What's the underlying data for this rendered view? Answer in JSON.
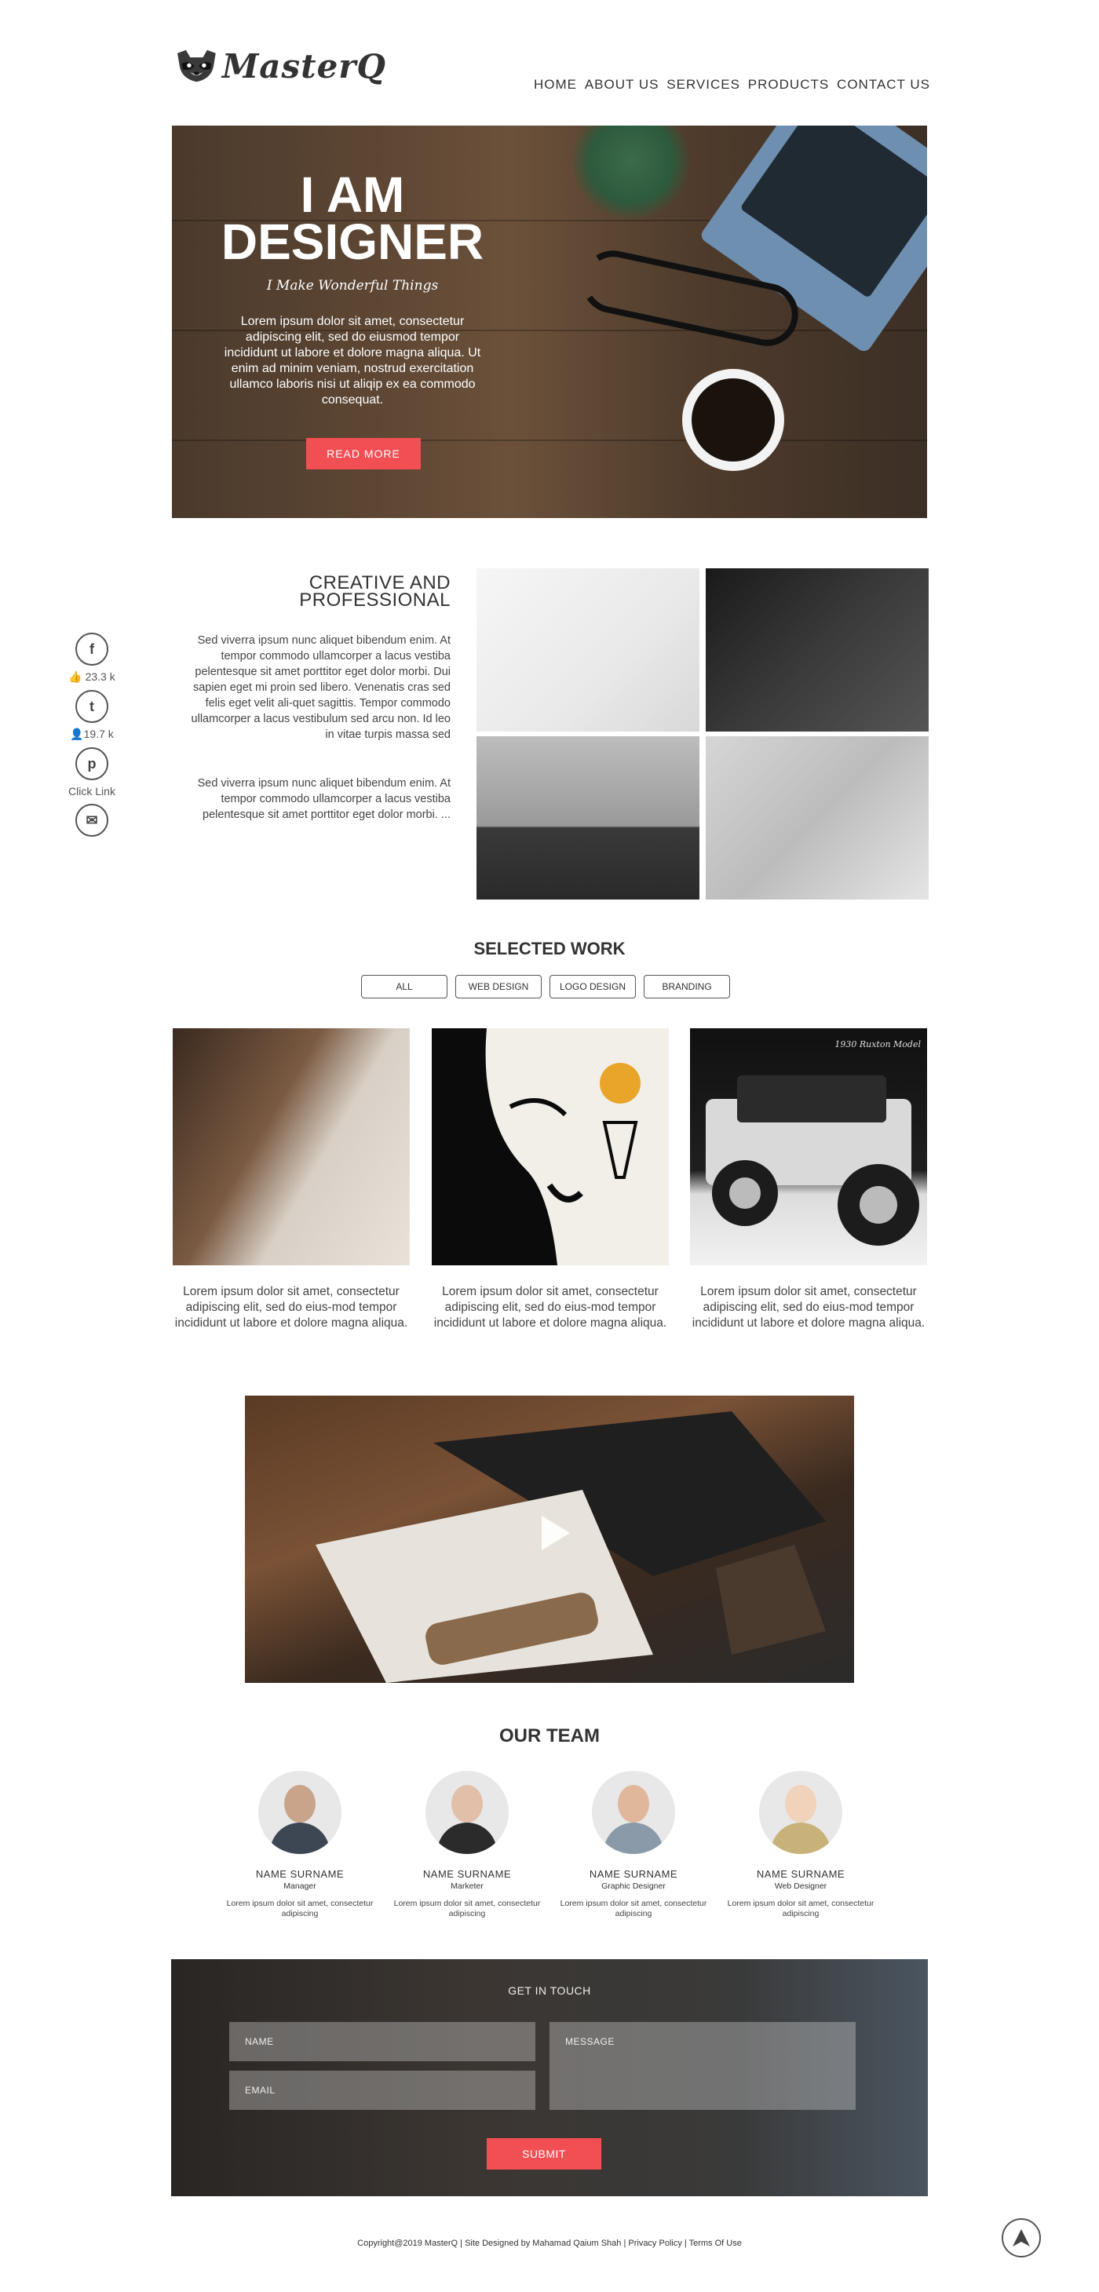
{
  "brand": {
    "name": "MasterQ",
    "logo_icon": "raccoon-logo-icon"
  },
  "nav": {
    "items": [
      {
        "label": "HOME"
      },
      {
        "label": "ABOUT US"
      },
      {
        "label": "SERVICES"
      },
      {
        "label": "PRODUCTS"
      },
      {
        "label": "CONTACT US"
      }
    ]
  },
  "hero": {
    "title_line1": "I AM",
    "title_line2": "DESIGNER",
    "subtitle": "I Make Wonderful Things",
    "body": "Lorem ipsum dolor sit amet, consectetur adipiscing elit, sed do eiusmod tempor incididunt ut labore et dolore magna aliqua. Ut enim ad minim veniam, nostrud exercitation ullamco laboris nisi ut aliqip ex ea commodo consequat.",
    "button": "READ MORE"
  },
  "social": {
    "items": [
      {
        "icon": "facebook-icon",
        "glyph": "f",
        "count": "23.3 k",
        "count_icon": "thumbs-up-icon"
      },
      {
        "icon": "twitter-icon",
        "glyph": "t",
        "count": "19.7 k",
        "count_icon": "user-icon"
      },
      {
        "icon": "pinterest-icon",
        "glyph": "p",
        "count": "Click Link",
        "count_icon": ""
      },
      {
        "icon": "mail-icon",
        "glyph": "✉",
        "count": "",
        "count_icon": ""
      }
    ]
  },
  "creative": {
    "title_line1": "CREATIVE AND",
    "title_line2": "PROFESSIONAL",
    "p1": "Sed viverra ipsum nunc aliquet bibendum enim. At tempor commodo ullamcorper a lacus vestiba pelentesque sit amet porttitor eget dolor morbi. Dui sapien eget mi proin sed libero. Venenatis cras sed felis eget velit ali-quet sagittis. Tempor commodo ullamcorper a lacus vestibulum sed arcu non. Id leo in vitae turpis massa sed",
    "p2": "Sed viverra ipsum nunc aliquet bibendum enim. At tempor commodo ullamcorper a lacus vestiba pelentesque sit amet porttitor eget dolor morbi. ..."
  },
  "selected_work": {
    "title": "SELECTED WORK",
    "filters": [
      {
        "label": "ALL"
      },
      {
        "label": "WEB DESIGN"
      },
      {
        "label": "LOGO DESIGN"
      },
      {
        "label": "BRANDING"
      }
    ],
    "items": [
      {
        "caption": "Lorem ipsum dolor sit amet, consectetur adipiscing elit, sed do eius-mod tempor incididunt ut labore et dolore magna aliqua."
      },
      {
        "caption": "Lorem ipsum dolor sit amet, consectetur adipiscing elit, sed do eius-mod tempor incididunt ut labore et dolore magna aliqua."
      },
      {
        "caption": "Lorem ipsum dolor sit amet, consectetur adipiscing elit, sed do eius-mod tempor incididunt ut labore et dolore magna aliqua.",
        "image_label": "1930 Ruxton Model"
      }
    ]
  },
  "team": {
    "title": "OUR TEAM",
    "members": [
      {
        "name": "NAME SURNAME",
        "role": "Manager",
        "desc": "Lorem ipsum dolor sit amet, consectetur adipiscing",
        "head": "#c9a48a",
        "body": "#3d4754"
      },
      {
        "name": "NAME SURNAME",
        "role": "Marketer",
        "desc": "Lorem ipsum dolor sit amet, consectetur adipiscing",
        "head": "#e2bfa8",
        "body": "#2b2b2b"
      },
      {
        "name": "NAME SURNAME",
        "role": "Graphic Designer",
        "desc": "Lorem ipsum dolor sit amet, consectetur adipiscing",
        "head": "#e0b79b",
        "body": "#8a9aa8"
      },
      {
        "name": "NAME SURNAME",
        "role": "Web Designer",
        "desc": "Lorem ipsum dolor sit amet, consectetur adipiscing",
        "head": "#f1d2bb",
        "body": "#c9b27a"
      }
    ]
  },
  "contact": {
    "title": "GET IN TOUCH",
    "name_placeholder": "NAME",
    "email_placeholder": "EMAIL",
    "message_placeholder": "MESSAGE",
    "submit": "SUBMIT"
  },
  "footer": {
    "text": "Copyright@2019 MasterQ | Site Designed by Mahamad Qaium Shah | Privacy Policy | Terms Of Use",
    "to_top_icon": "arrow-up-icon"
  },
  "colors": {
    "accent": "#f24f54",
    "text": "#333333"
  }
}
